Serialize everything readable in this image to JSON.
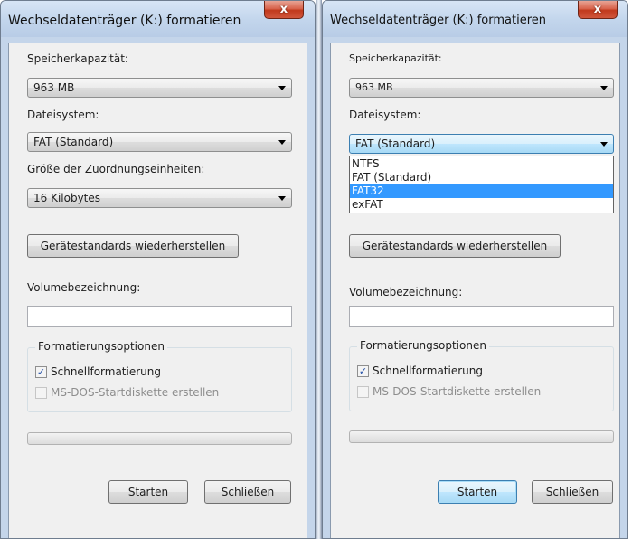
{
  "dialog_title": "Wechseldatenträger (K:) formatieren",
  "close_glyph": "x",
  "labels": {
    "capacity": "Speicherkapazität:",
    "filesystem": "Dateisystem:",
    "allocation": "Größe der Zuordnungseinheiten:",
    "volume_label": "Volumebezeichnung:",
    "format_options": "Formatierungsoptionen"
  },
  "values": {
    "capacity": "963 MB",
    "filesystem": "FAT (Standard)",
    "allocation": "16 Kilobytes",
    "volume_label": ""
  },
  "buttons": {
    "restore_defaults": "Gerätestandards wiederherstellen",
    "start": "Starten",
    "close": "Schließen"
  },
  "checkboxes": {
    "quick_format": {
      "label": "Schnellformatierung",
      "checked": true,
      "enabled": true
    },
    "msdos_startup": {
      "label": "MS-DOS-Startdiskette erstellen",
      "checked": false,
      "enabled": false
    }
  },
  "progress": 0,
  "filesystem_options": [
    "NTFS",
    "FAT (Standard)",
    "FAT32",
    "exFAT"
  ],
  "highlighted_option": "FAT32",
  "colors": {
    "highlight": "#3399ff",
    "close_button": "#c1391c",
    "frame": "#c4d5ea"
  },
  "icons": {
    "close": "close-icon",
    "dropdown": "chevron-down-icon",
    "check": "check-icon"
  }
}
